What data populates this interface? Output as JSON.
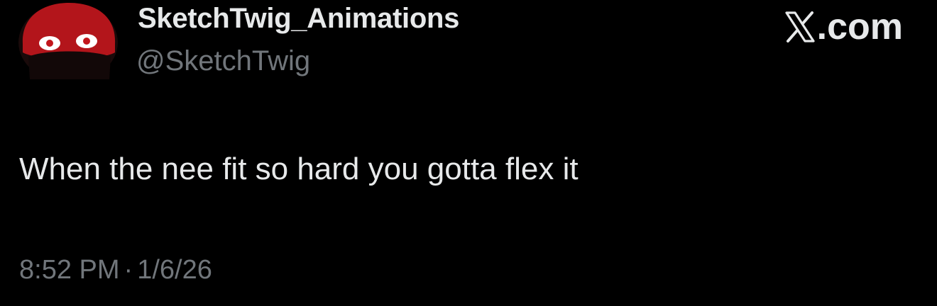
{
  "author": {
    "display_name": "SketchTwig_Animations",
    "handle": "@SketchTwig",
    "avatar_icon": "red-mask-face-icon"
  },
  "brand": {
    "text": ".com",
    "logo_icon": "x-logo-icon"
  },
  "tweet": {
    "text": "When the nee fit so hard you gotta flex it",
    "time": "8:52 PM",
    "separator": "·",
    "date": "1/6/26"
  },
  "colors": {
    "background": "#000000",
    "primary_text": "#e7e9ea",
    "secondary_text": "#71767b",
    "avatar_red": "#b3151b"
  }
}
